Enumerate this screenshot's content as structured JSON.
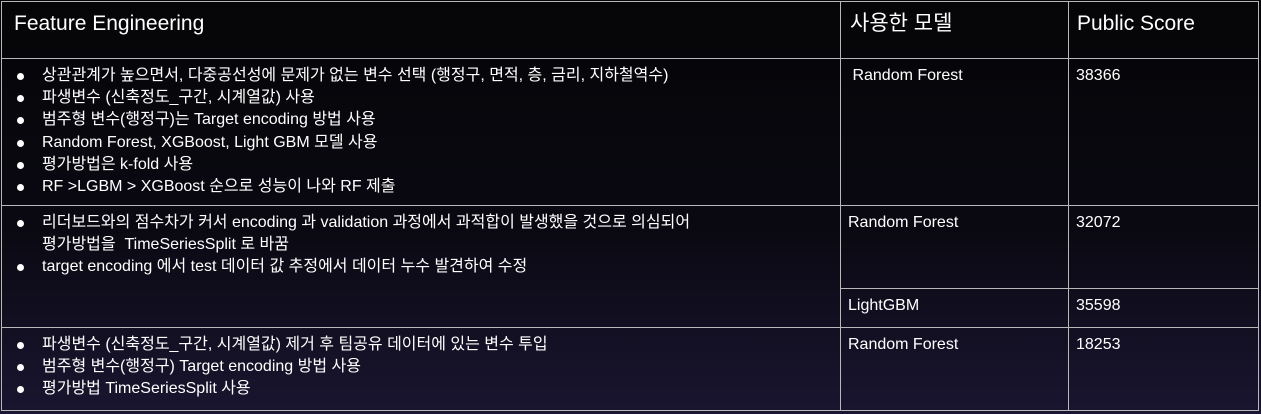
{
  "header": {
    "feature_engineering": "Feature Engineering",
    "model": "사용한 모델",
    "public_score": "Public Score"
  },
  "rows": [
    {
      "features": [
        "상관관계가 높으면서, 다중공선성에 문제가 없는 변수 선택 (행정구, 면적, 층, 금리, 지하철역수)",
        "파생변수 (신축정도_구간, 시계열값) 사용",
        "범주형 변수(행정구)는 Target encoding 방법 사용",
        "Random Forest, XGBoost, Light GBM 모델 사용",
        "평가방법은 k-fold 사용",
        "RF >LGBM > XGBoost 순으로 성능이 나와 RF 제출"
      ],
      "model": " Random Forest",
      "score": "38366"
    },
    {
      "features": [
        "리더보드와의 점수차가 커서 encoding 과 validation 과정에서 과적합이 발생했을 것으로 의심되어\n평가방법을  TimeSeriesSplit 로 바꿈",
        "target encoding 에서 test 데이터 값 추정에서 데이터 누수 발견하여 수정"
      ],
      "model": "Random Forest",
      "score": "32072"
    },
    {
      "model": "LightGBM",
      "score": "35598"
    },
    {
      "features": [
        "파생변수 (신축정도_구간, 시계열값) 제거 후 팀공유 데이터에 있는 변수 투입",
        "범주형 변수(행정구) Target encoding 방법 사용",
        "평가방법 TimeSeriesSplit 사용"
      ],
      "model": "Random Forest",
      "score": "18253"
    }
  ]
}
